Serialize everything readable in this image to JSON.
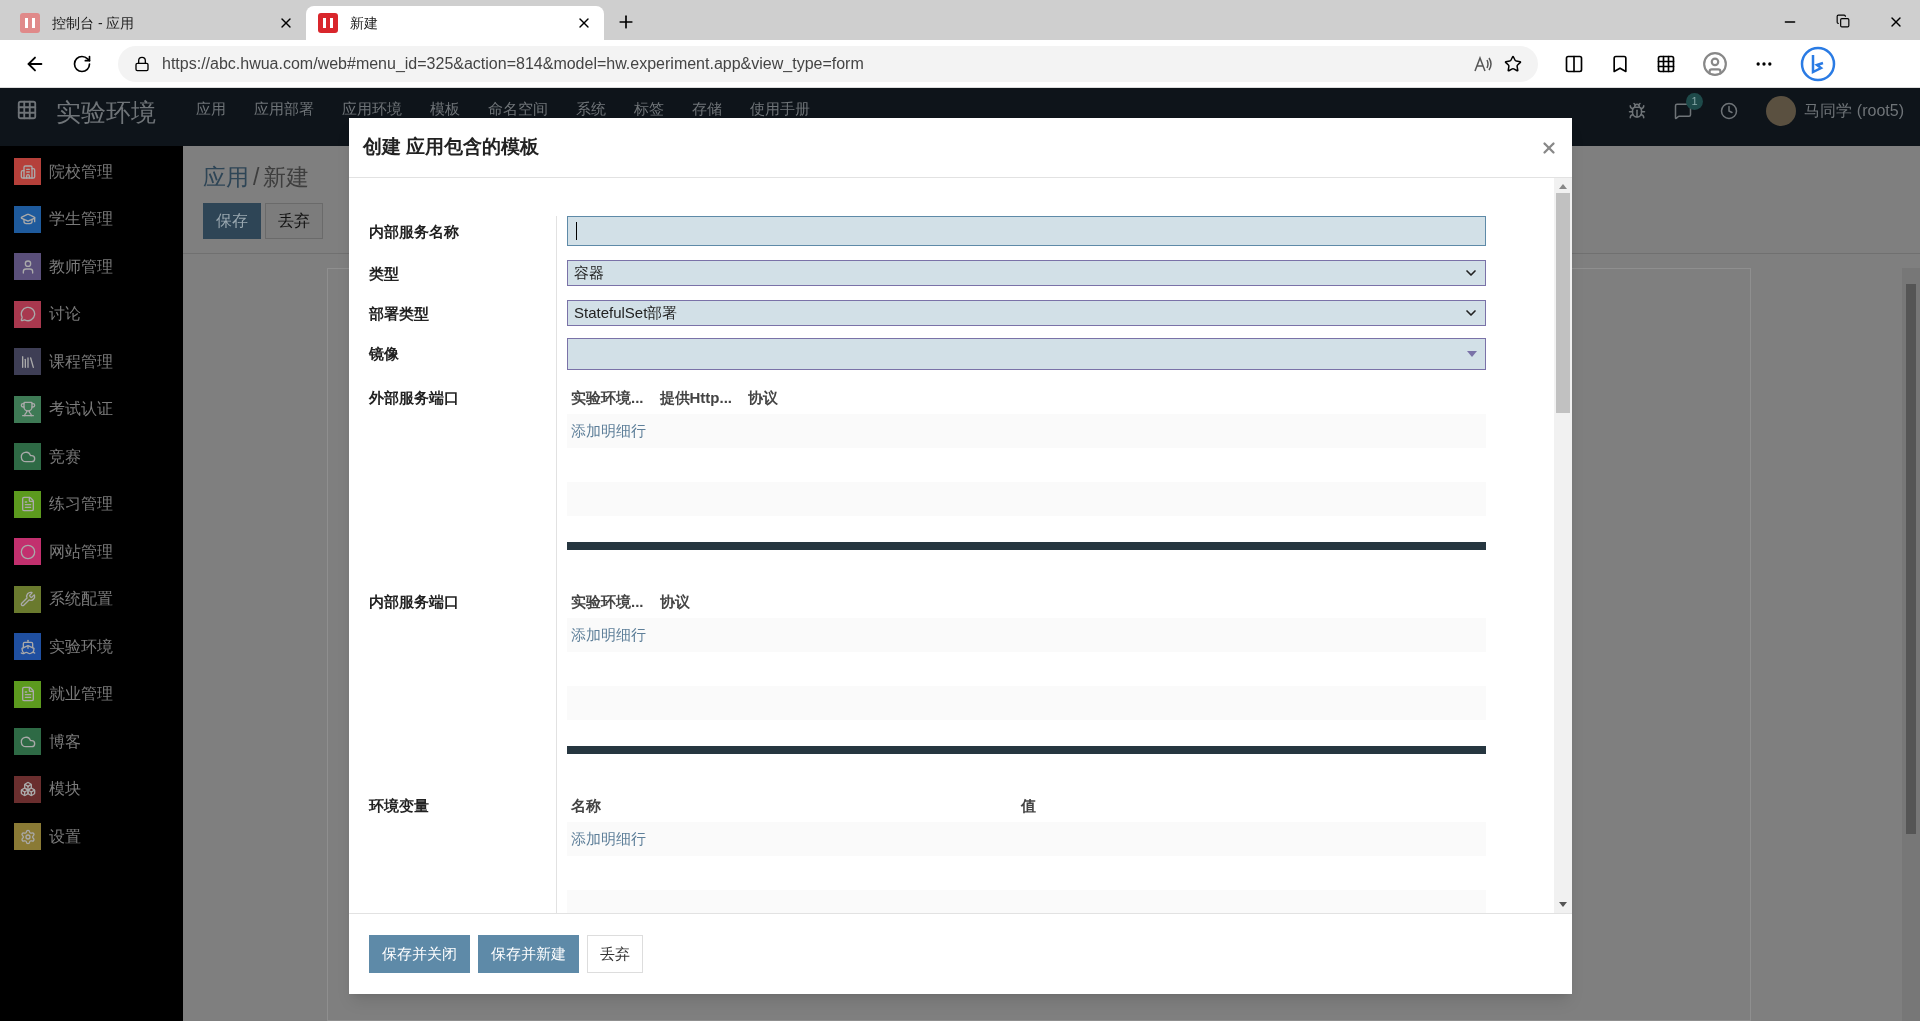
{
  "browser": {
    "tabs": [
      {
        "title": "控制台 - 应用",
        "selected": false
      },
      {
        "title": "新建",
        "selected": true
      }
    ],
    "url": "https://abc.hwua.com/web#menu_id=325&action=814&model=hw.experiment.app&view_type=form"
  },
  "navbar": {
    "brand": "实验环境",
    "menu": [
      "应用",
      "应用部署",
      "应用环境",
      "模板",
      "命名空间",
      "系统",
      "标签",
      "存储",
      "使用手册"
    ],
    "chat_count": "1",
    "user": "马同学 (root5)"
  },
  "sidebar": {
    "items": [
      {
        "label": "院校管理",
        "color": "#b5403a"
      },
      {
        "label": "学生管理",
        "color": "#1e5a9c"
      },
      {
        "label": "教师管理",
        "color": "#5a4f7a"
      },
      {
        "label": "讨论",
        "color": "#a8384e"
      },
      {
        "label": "课程管理",
        "color": "#3e3e55"
      },
      {
        "label": "考试认证",
        "color": "#3e7a55"
      },
      {
        "label": "竞赛",
        "color": "#2e6a45"
      },
      {
        "label": "练习管理",
        "color": "#5c9a1e"
      },
      {
        "label": "网站管理",
        "color": "#c2306e"
      },
      {
        "label": "系统配置",
        "color": "#6a7a2e"
      },
      {
        "label": "实验环境",
        "color": "#1f4fa0"
      },
      {
        "label": "就业管理",
        "color": "#5c9a1e"
      },
      {
        "label": "博客",
        "color": "#2e6a45"
      },
      {
        "label": "模块",
        "color": "#6a2e2e"
      },
      {
        "label": "设置",
        "color": "#8a7a35"
      }
    ]
  },
  "page": {
    "breadcrumb": [
      "应用",
      "/",
      "新建"
    ],
    "buttons": [
      {
        "label": "保存",
        "kind": "primary"
      },
      {
        "label": "丢弃",
        "kind": "secondary"
      }
    ]
  },
  "dialog": {
    "title": "创建 应用包含的模板",
    "fields": [
      {
        "label": "内部服务名称",
        "kind": "text",
        "focused": true
      },
      {
        "label": "类型",
        "kind": "select",
        "value": "容器"
      },
      {
        "label": "部署类型",
        "kind": "select",
        "value": "StatefulSet部署"
      },
      {
        "label": "镜像",
        "kind": "combo"
      },
      {
        "label": "外部服务端口",
        "kind": "table",
        "columns": [
          "实验环境...",
          "提供Http...",
          "协议"
        ],
        "add_line": "添加明细行"
      },
      {
        "label": "内部服务端口",
        "kind": "table",
        "columns": [
          "实验环境...",
          "协议"
        ],
        "add_line": "添加明细行"
      },
      {
        "label": "环境变量",
        "kind": "table",
        "columns": [
          "名称",
          "值"
        ],
        "add_line": "添加明细行"
      }
    ],
    "buttons": [
      {
        "label": "保存并关闭",
        "kind": "primary"
      },
      {
        "label": "保存并新建",
        "kind": "primary"
      },
      {
        "label": "丢弃",
        "kind": "secondary"
      }
    ]
  }
}
